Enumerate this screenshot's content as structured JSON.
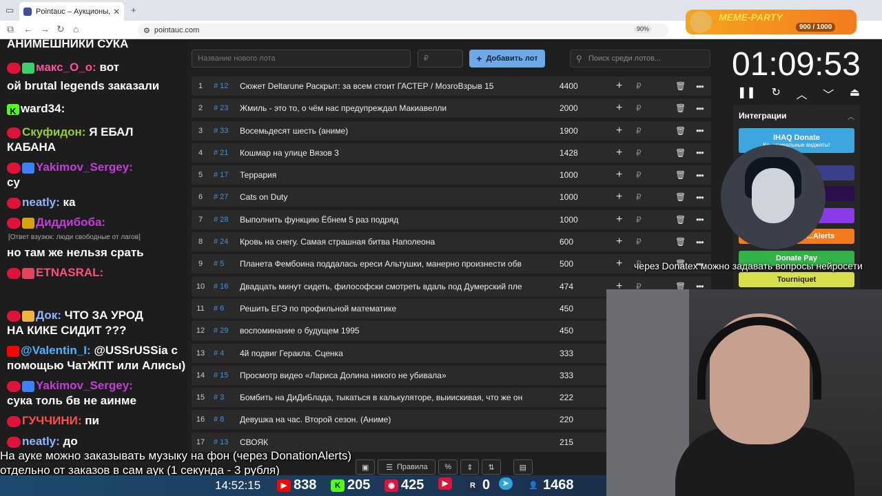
{
  "browser": {
    "tab_title": "Pointauc – Аукционы, лотереи",
    "url": "pointauc.com",
    "zoom": "90%"
  },
  "chat": [
    {
      "user": "",
      "text": "АНИМЕШНИКИ СУКА"
    },
    {
      "user": "макс_О_о:",
      "text": "вот",
      "color": "#ff4f9e"
    },
    {
      "user": "",
      "text": "ой brutal legends заказали"
    },
    {
      "user": "ward34:",
      "text": "",
      "color": "#ffffff"
    },
    {
      "user": "Скуфидон:",
      "text": "Я ЕБАЛ",
      "color": "#9acd32"
    },
    {
      "user": "",
      "text": "КАБАНА"
    },
    {
      "user": "Yakimov_Sergey:",
      "text": "",
      "color": "#c13fd6"
    },
    {
      "user": "",
      "text": "су"
    },
    {
      "user": "neatly:",
      "text": "ка",
      "color": "#8fb5ff"
    },
    {
      "user": "Диддибоба:",
      "text": "",
      "color": "#c13fd6"
    },
    {
      "reply": "[Ответ взузюк: люди свободные от лагов]"
    },
    {
      "user": "",
      "text": "но там же нельзя срать"
    },
    {
      "user": "ЕТNASRAL:",
      "text": "",
      "color": "#ff4f7a"
    },
    {
      "user": "Док:",
      "text": "ЧТО ЗА УРОД",
      "color": "#8fb5ff"
    },
    {
      "user": "",
      "text": "НА КИКЕ СИДИТ ???"
    },
    {
      "user": "@Valentin_I:",
      "text": "@USSrUSSia с",
      "color": "#4fb3ff"
    },
    {
      "user": "",
      "text": "помощью ЧатЖПТ или Алисы)"
    },
    {
      "user": "Yakimov_Sergey:",
      "text": "",
      "color": "#c13fd6"
    },
    {
      "user": "",
      "text": "сука толь бв не аинме"
    },
    {
      "user": "ГУЧЧИНИ:",
      "text": "пи",
      "color": "#ff4f4f"
    },
    {
      "user": "neatly:",
      "text": "до",
      "color": "#8fb5ff"
    }
  ],
  "form": {
    "lot_placeholder": "Название нового лота",
    "price_placeholder": "₽",
    "add_label": "Добавить лот",
    "search_placeholder": "Поиск среди лотов..."
  },
  "lots": [
    {
      "n": "1",
      "id": "# 12",
      "name": "Сюжет Deltarune Раскрыт: за всем стоит ГАСТЕР / МозгоВзрыв 15",
      "amount": "4400"
    },
    {
      "n": "2",
      "id": "# 23",
      "name": "Жмиль - это то, о чём нас предупреждал Макиавелли",
      "amount": "2000"
    },
    {
      "n": "3",
      "id": "# 33",
      "name": "Восемьдесят шесть (аниме)",
      "amount": "1900"
    },
    {
      "n": "4",
      "id": "# 21",
      "name": "Кошмар на улице Вязов 3",
      "amount": "1428"
    },
    {
      "n": "5",
      "id": "# 17",
      "name": "Террария",
      "amount": "1000"
    },
    {
      "n": "6",
      "id": "# 27",
      "name": "Cats on Duty",
      "amount": "1000"
    },
    {
      "n": "7",
      "id": "# 28",
      "name": "Выполнить функцию Ёбнем 5 раз подряд",
      "amount": "1000"
    },
    {
      "n": "8",
      "id": "# 24",
      "name": "Кровь на снегу. Самая страшная битва Наполеона",
      "amount": "600"
    },
    {
      "n": "9",
      "id": "# 5",
      "name": "Планета Фембоина поддалась ереси Альтушки, манерно произнести обв",
      "amount": "500"
    },
    {
      "n": "10",
      "id": "# 16",
      "name": "Двадцать минут сидеть, философски смотреть вдаль под Думерский пле",
      "amount": "474"
    },
    {
      "n": "11",
      "id": "# 6",
      "name": "Решить ЕГЭ по профильной математике",
      "amount": "450"
    },
    {
      "n": "12",
      "id": "# 29",
      "name": "воспоминание о будущем 1995",
      "amount": "450"
    },
    {
      "n": "13",
      "id": "# 4",
      "name": "4й подвиг Геракла. Сценка",
      "amount": "333"
    },
    {
      "n": "14",
      "id": "# 15",
      "name": "Просмотр видео «Лариса Долина никого не убивала»",
      "amount": "333"
    },
    {
      "n": "15",
      "id": "# 3",
      "name": "Бомбить на ДиДиБлада, тыкаться в калькуляторе, выиискивая, что же он",
      "amount": "222"
    },
    {
      "n": "16",
      "id": "# 8",
      "name": "Девушка на час. Второй сезон. (Аниме)",
      "amount": "220"
    },
    {
      "n": "17",
      "id": "# 13",
      "name": "СВОЯК",
      "amount": "215"
    }
  ],
  "timer": "01:09:53",
  "integrations": {
    "title": "Интеграции",
    "ihaq": "IHAQ Donate",
    "ihaq_sub": "Ко...уникальные виджеты!",
    "alerts": "...Alerts",
    "donatepay": "Donate Pay",
    "tourniquet": "Tourniquet"
  },
  "meme": {
    "title": "MEME-PARTY",
    "count": "900 / 1000"
  },
  "overlay": {
    "donatex": "через Donatex можно задавать вопросы нейросети",
    "line1": "На ауке можно заказывать музыку на фон (через DonationAlerts)",
    "line2": "отдельно от заказов в сам аук (1 секунда - 3 рубля)"
  },
  "tools": {
    "rules": "Правила",
    "percent": "%"
  },
  "stats": {
    "time": "14:52:15",
    "youtube": "838",
    "kick": "205",
    "vk": "425",
    "rutube": "",
    "r": "0",
    "total": "1468"
  }
}
